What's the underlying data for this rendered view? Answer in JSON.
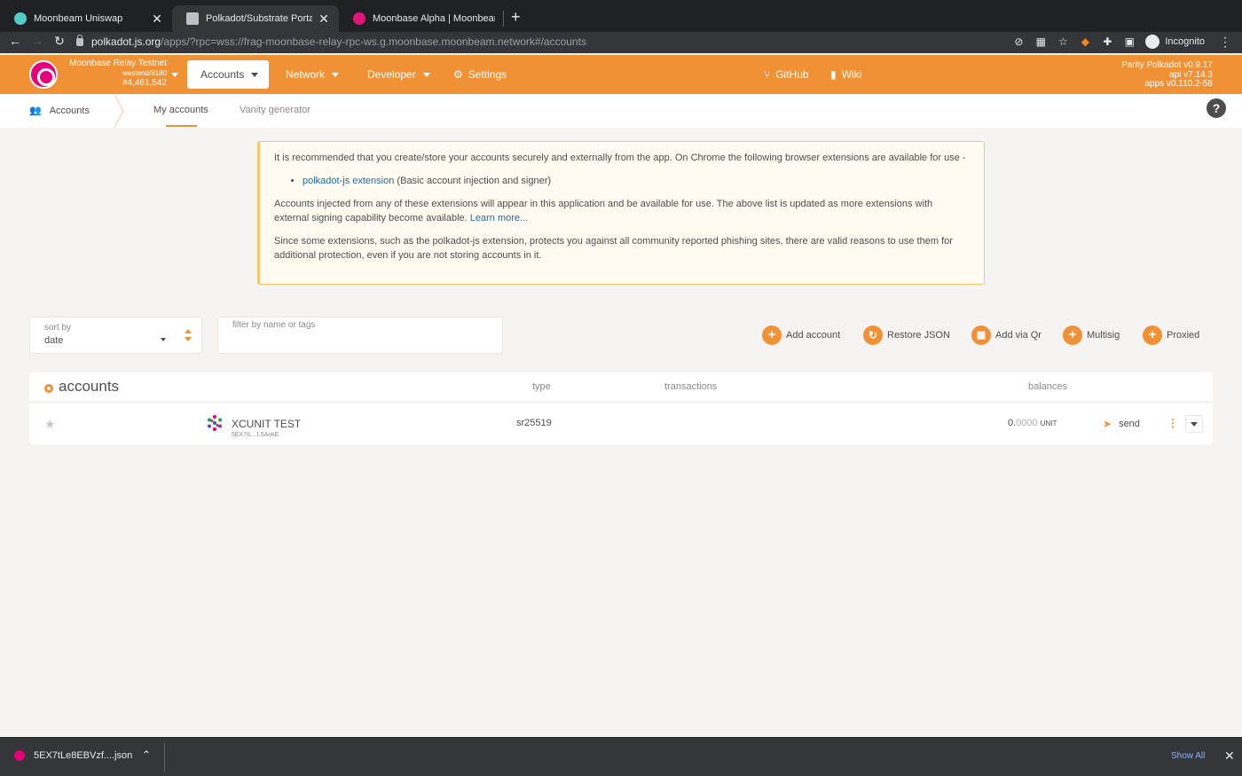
{
  "browser": {
    "tabs": [
      {
        "title": "Moonbeam Uniswap",
        "favicon_color": "#53cbc9",
        "active": false
      },
      {
        "title": "Polkadot/Substrate Portal",
        "favicon_color": "#bdc1c6",
        "active": true
      },
      {
        "title": "Moonbase Alpha | Moonbeam",
        "favicon_color": "#e1147b",
        "active": false
      }
    ],
    "url_host": "polkadot.js.org",
    "url_path": "/apps/?rpc=wss://frag-moonbase-relay-rpc-ws.g.moonbase.moonbeam.network#/accounts",
    "profile_label": "Incognito"
  },
  "header": {
    "chain_name": "Moonbase Relay Testnet",
    "chain_runtime": "westend/9180",
    "chain_block": "#4,461,542",
    "menu": {
      "accounts": "Accounts",
      "network": "Network",
      "developer": "Developer",
      "settings": "Settings",
      "github": "GitHub",
      "wiki": "Wiki"
    },
    "version_node": "Parity Polkadot v0.9.17",
    "version_api": "api v7.14.3",
    "version_apps": "apps v0.110.2-58",
    "accent_color": "#f19135"
  },
  "subnav": {
    "section": "Accounts",
    "tabs": [
      "My accounts",
      "Vanity generator"
    ],
    "help": "?"
  },
  "notice": {
    "intro": "It is recommended that you create/store your accounts securely and externally from the app. On Chrome the following browser extensions are available for use -",
    "ext_link": "polkadot-js extension",
    "ext_desc": " (Basic account injection and signer)",
    "para2": "Accounts injected from any of these extensions will appear in this application and be available for use. The above list is updated as more extensions with external signing capability become available. ",
    "learn_more": "Learn more...",
    "para3": "Since some extensions, such as the polkadot-js extension, protects you against all community reported phishing sites, there are valid reasons to use them for additional protection, even if you are not storing accounts in it."
  },
  "controls": {
    "sort_label": "sort by",
    "sort_value": "date",
    "filter_placeholder": "filter by name or tags",
    "filter_value": "",
    "actions": {
      "add_account": "Add account",
      "restore_json": "Restore JSON",
      "add_via_qr": "Add via Qr",
      "multisig": "Multisig",
      "proxied": "Proxied"
    }
  },
  "table": {
    "title": "accounts",
    "columns": {
      "type": "type",
      "transactions": "transactions",
      "balances": "balances"
    },
    "rows": [
      {
        "name": "XCUNIT TEST",
        "address": "5EX7tL...L5AokE",
        "type": "sr25519",
        "balance_int": "0.",
        "balance_dec": "0000",
        "unit": "UNIT",
        "send": "send"
      }
    ]
  },
  "downloads": {
    "file": "5EX7tLe8EBVzf....json",
    "show_all": "Show All"
  }
}
